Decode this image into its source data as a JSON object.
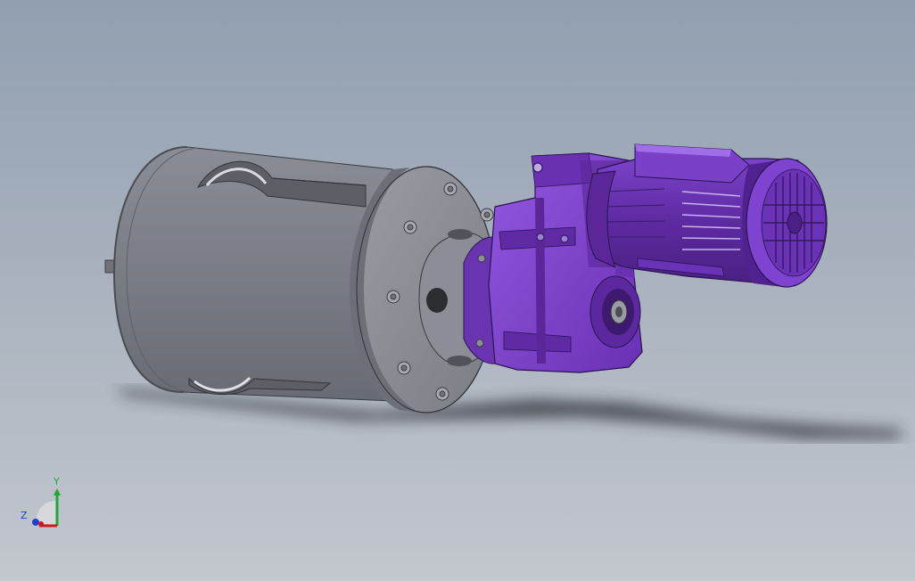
{
  "viewport": {
    "background_top": "#919fb0",
    "background_bottom": "#c3c7ce"
  },
  "colors": {
    "drum_body": "#7d8088",
    "drum_flange": "#8e9099",
    "hub": "#858891",
    "bolt": "#a7a9b0",
    "gearbox_purple": "#7a3ec7",
    "gearbox_shadow": "#4a2280",
    "motor_purple": "#8547d6",
    "shadow": "#2c2f36"
  },
  "triad": {
    "y_label": "Y",
    "z_label": "Z",
    "y_color": "#22a63a",
    "z_color": "#1f3fd0",
    "x_color": "#d01818"
  },
  "icons": [
    "coordinate-triad-icon"
  ]
}
